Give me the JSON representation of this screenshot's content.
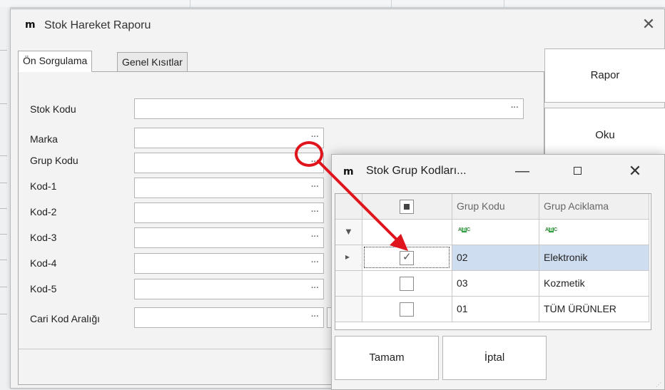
{
  "main_window": {
    "title": "Stok Hareket Raporu",
    "close_glyph": "✕",
    "logo_text": "m"
  },
  "tabs": [
    {
      "label": "Ön Sorgulama",
      "active": true
    },
    {
      "label": "Genel Kısıtlar",
      "active": false
    }
  ],
  "fields": [
    {
      "label": "Stok Kodu",
      "value": ""
    },
    {
      "label": "Marka",
      "value": ""
    },
    {
      "label": "Grup Kodu",
      "value": ""
    },
    {
      "label": "Kod-1",
      "value": ""
    },
    {
      "label": "Kod-2",
      "value": ""
    },
    {
      "label": "Kod-3",
      "value": ""
    },
    {
      "label": "Kod-4",
      "value": ""
    },
    {
      "label": "Kod-5",
      "value": ""
    },
    {
      "label": "Cari Kod Aralığı",
      "value": ""
    }
  ],
  "ellipsis": "···",
  "side_buttons": {
    "rapor": "Rapor",
    "oku": "Oku"
  },
  "popup": {
    "title": "Stok Grup Kodları...",
    "minimize_glyph": "—",
    "close_glyph": "✕",
    "columns": [
      "Grup Kodu",
      "Grup Aciklama"
    ],
    "filter_glyph": "▼",
    "row_indicator": "▸",
    "rows": [
      {
        "checked": true,
        "code": "02",
        "description": "Elektronik",
        "selected": true
      },
      {
        "checked": false,
        "code": "03",
        "description": "Kozmetik",
        "selected": false
      },
      {
        "checked": false,
        "code": "01",
        "description": "TÜM ÜRÜNLER",
        "selected": false
      }
    ],
    "ok_label": "Tamam",
    "cancel_label": "İptal"
  },
  "colors": {
    "highlight": "#e0141c",
    "selected_row": "#cfddf0",
    "abc_green": "#2e9e3e"
  }
}
